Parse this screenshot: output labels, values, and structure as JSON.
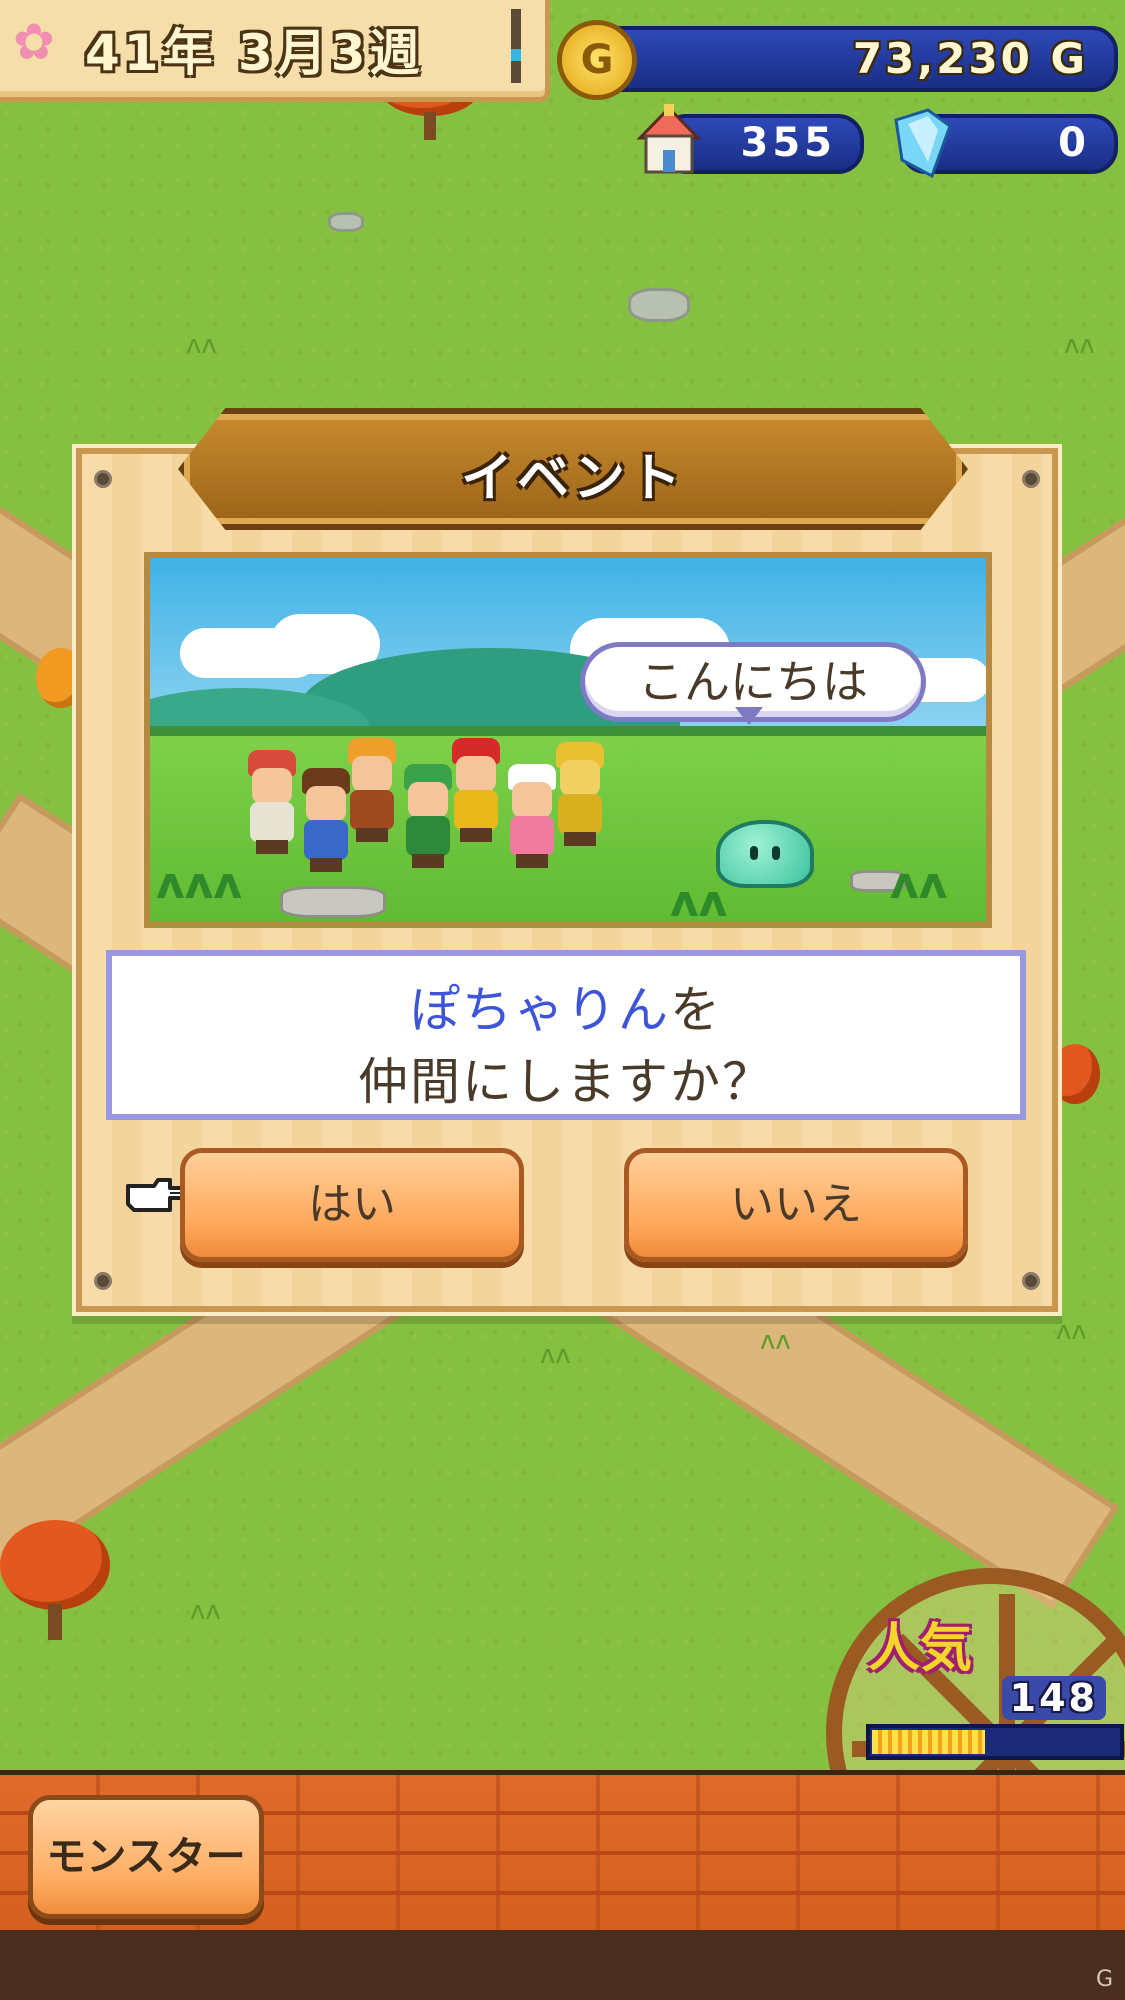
{
  "hud": {
    "date": "41年 3月3週",
    "gold": "73,230 G",
    "gold_coin_letter": "G",
    "town_count": "355",
    "crystal_count": "0",
    "icons": {
      "season": "cherry-blossom-icon",
      "gold": "gold-coin-icon",
      "town": "house-icon",
      "crystal": "blue-crystal-icon"
    }
  },
  "dialog": {
    "title": "イベント",
    "speech_bubble": "こんにちは",
    "message_name": "ぽちゃりん",
    "message_suffix": "を",
    "message_line2": "仲間にしますか？",
    "yes_label": "はい",
    "no_label": "いいえ",
    "selection_icon": "pointing-hand-icon",
    "colors": {
      "name": "#3d55d6",
      "text": "#4a3a2a",
      "button": "#ffa75a"
    }
  },
  "popularity": {
    "label": "人気",
    "value": "148",
    "gauge_fraction": 0.46
  },
  "bottom_bar": {
    "monster_label": "モンスター"
  },
  "watermark": "G"
}
